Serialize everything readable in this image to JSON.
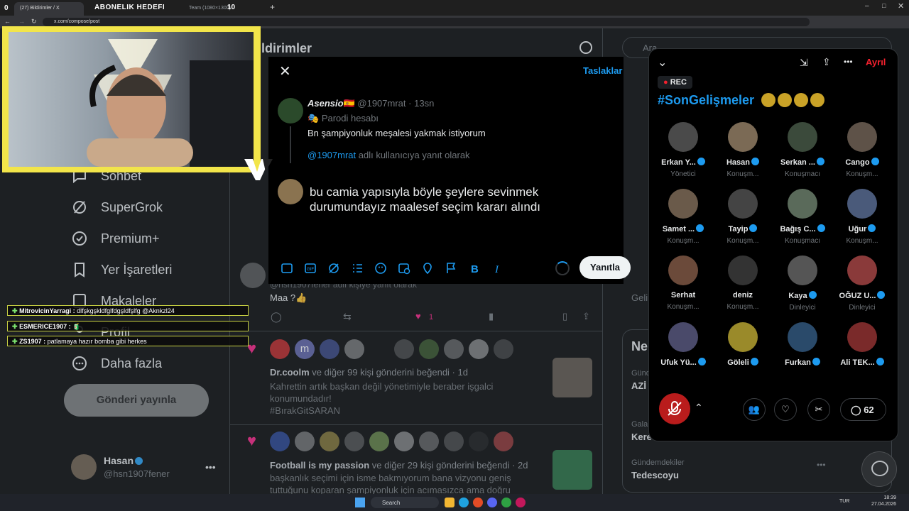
{
  "browser": {
    "tabs": [
      "(27) Bildirimler / X",
      "ABONELIK HEDEFI",
      "Team (1080×1300)"
    ],
    "tab_counter_left": "0",
    "tab_counter_right": "10",
    "url": "x.com/compose/post"
  },
  "nav": {
    "header_partial": "ldirimler",
    "items": [
      "Sohbet",
      "SuperGrok",
      "Premium+",
      "Yer İşaretleri",
      "Makaleler",
      "Profil",
      "Daha fazla"
    ],
    "post_button": "Gönderi yayınla",
    "account_name": "Hasan",
    "account_handle": "@hsn1907fener"
  },
  "compose": {
    "drafts": "Taslaklar",
    "original": {
      "name": "Asensio",
      "flag": "🇪🇸",
      "handle": "@1907mrat",
      "time": "13sn",
      "badge": "Parodi hesabı",
      "text": "Bn şampiyonluk meşalesi yakmak istiyorum"
    },
    "reply_to_handle": "@1907mrat",
    "reply_to_suffix": "adlı kullanıcıya yanıt olarak",
    "draft_text_line1": "bu camia yapısıyla böyle şeylere sevinmek",
    "draft_text_line2": "durumundayız maalesef seçim kararı alındı",
    "reply_button": "Yanıtla"
  },
  "feed": {
    "reply_snippet_handle": "@hsn1907fener",
    "reply_snippet_suffix": "adlı kişiye yanıt olarak",
    "reply_text": "Maa ?👍",
    "like_count": "1",
    "like_group1": {
      "who": "Dr.coolm",
      "rest": "ve diğer 99 kişi gönderini beğendi",
      "time": "1d",
      "text": "Kahrettin artık başkan değil yönetimiyle beraber işgalci konumundadır!",
      "hashtag": "#BırakGitSARAN",
      "avatar_letter": "m"
    },
    "like_group2": {
      "who": "Football is my passion",
      "rest": "ve diğer 29 kişi gönderini beğendi",
      "time": "2d",
      "text_line1": "başkanlık seçimi için isme bakmıyorum bana vizyonu geniş",
      "text_line2": "tuttuğunu koparan şampiyonluk için acımasızca ama doğru"
    }
  },
  "right_rail": {
    "search_placeholder": "Ara",
    "gel": "Geli",
    "news_header": "Ne",
    "trends": [
      {
        "label": "Günd",
        "topic": "AZİ"
      },
      {
        "label": "Gala",
        "topic": "Kere"
      },
      {
        "label": "Gündemdekiler",
        "topic": "Tedescoyu"
      }
    ]
  },
  "chat": [
    {
      "user": "MitrovicinYarragi",
      "msg": "dlfşkgşkldfglfdgşldfşlfg @Aknkzl24"
    },
    {
      "user": "ESMERICE1907",
      "msg": "🧃"
    },
    {
      "user": "ZS1907",
      "msg": "patlamaya hazır bomba gibi herkes"
    }
  ],
  "spaces": {
    "leave": "Ayrıl",
    "rec": "REC",
    "title": "#SonGelişmeler",
    "listener_count": "62",
    "participants": [
      {
        "name": "Erkan Y...",
        "role": "Yönetici",
        "verified": true
      },
      {
        "name": "Hasan",
        "role": "Konuşm...",
        "verified": true
      },
      {
        "name": "Serkan ...",
        "role": "Konuşmacı",
        "verified": true
      },
      {
        "name": "Cango",
        "role": "Konuşm...",
        "verified": true
      },
      {
        "name": "Samet ...",
        "role": "Konuşm...",
        "verified": true
      },
      {
        "name": "Tayip",
        "role": "Konuşm...",
        "verified": true
      },
      {
        "name": "Bağış C...",
        "role": "Konuşmacı",
        "verified": true
      },
      {
        "name": "Uğur",
        "role": "Konuşm...",
        "verified": true
      },
      {
        "name": "Serhat",
        "role": "Konuşm...",
        "verified": false
      },
      {
        "name": "deniz",
        "role": "Konuşm...",
        "verified": false
      },
      {
        "name": "Kaya",
        "role": "Dinleyici",
        "verified": true
      },
      {
        "name": "OĞUZ U...",
        "role": "Dinleyici",
        "verified": true
      },
      {
        "name": "Ufuk Yü...",
        "role": "",
        "verified": true
      },
      {
        "name": "Göleli",
        "role": "",
        "verified": true
      },
      {
        "name": "Furkan",
        "role": "",
        "verified": true
      },
      {
        "name": "Ali TEK...",
        "role": "",
        "verified": true
      }
    ]
  },
  "taskbar": {
    "search": "Search",
    "lang": "TUR",
    "time": "18:39",
    "date": "27.04.2026"
  },
  "colors": {
    "accent": "#1d9bf0",
    "like": "#f91880",
    "gold": "#c9a227",
    "webcam_border": "#f2e54a",
    "spaces_leave": "#f4212e"
  }
}
